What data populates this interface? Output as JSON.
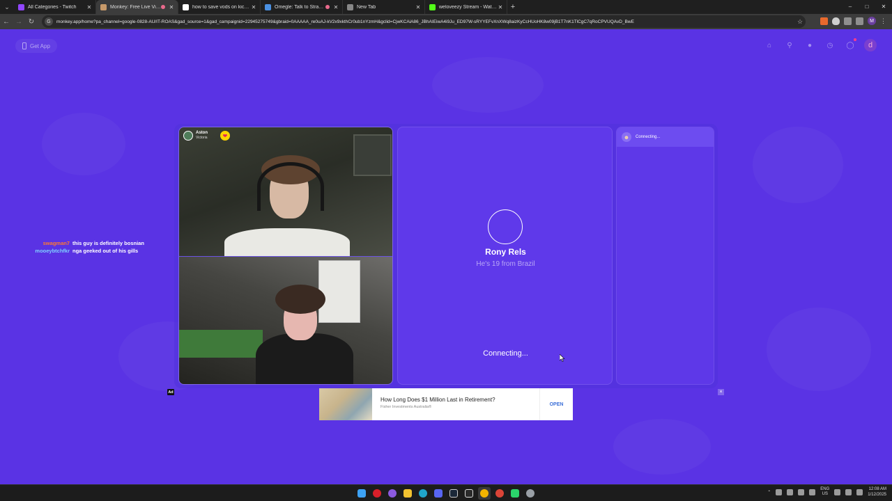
{
  "browser": {
    "tabs": [
      {
        "title": "All Categories - Twitch",
        "favicon_color": "#9146ff",
        "recording": false,
        "active": false
      },
      {
        "title": "Monkey: Free Live Video Ch",
        "favicon_color": "#c89a6a",
        "recording": true,
        "active": true
      },
      {
        "title": "how to save vods on kick - Goo",
        "favicon_color": "#ffffff",
        "recording": false,
        "active": false
      },
      {
        "title": "Omegle: Talk to Strangers -",
        "favicon_color": "#4a90e2",
        "recording": true,
        "active": false
      },
      {
        "title": "New Tab",
        "favicon_color": "#888888",
        "recording": false,
        "active": false
      },
      {
        "title": "weloveezy Stream - Watch Li",
        "favicon_color": "#53fc18",
        "recording": false,
        "active": false
      }
    ],
    "url": "monkey.app/home?pa_channel=google-0828-AU/IT-ROAS&gad_source=1&gad_campaignid=22945275749&gbraid=0AAAAA_re0uAJ-kV2x9xkthCr0ub1nYzmH&gclid=CjwKCAiA86_JBhAIEiwA4i9Ju_ED97W-sRYYEFvXnXWq8aizKyCcHUoHK8w09jB1T7nK1TlCgC7qRoCPVUQAvD_BwE",
    "profile_initial": "M"
  },
  "header": {
    "get_app_label": "Get App",
    "icons": [
      "house-icon",
      "search-icon",
      "globe-icon",
      "clock-icon",
      "chat-icon"
    ],
    "avatar_initial": "d"
  },
  "left_video": {
    "caller_name": "Aston",
    "caller_location": "Victoria"
  },
  "match": {
    "name": "Rony Rels",
    "subtitle": "He's 19 from Brazil",
    "status": "Connecting..."
  },
  "chat": {
    "status": "Connecting..."
  },
  "overlay_chat": [
    {
      "user": "swagman7",
      "user_color": "#ff7a2e",
      "message": "this guy is definitely bosnian"
    },
    {
      "user": "mooeybtchfkr",
      "user_color": "#7fd0ff",
      "message": "nga geeked out of his gills"
    }
  ],
  "ad": {
    "badge": "Ad",
    "title": "How Long Does $1 Million Last in Retirement?",
    "source": "Fisher Investments Australia®",
    "cta": "OPEN",
    "close": "×"
  },
  "taskbar": {
    "language": "ENG",
    "region": "US",
    "time": "12:08 AM",
    "date": "1/12/2025"
  },
  "colors": {
    "page_bg": "#5a33e4",
    "panel_bg": "#5f39ea",
    "accent_heart": "#ffd400"
  }
}
